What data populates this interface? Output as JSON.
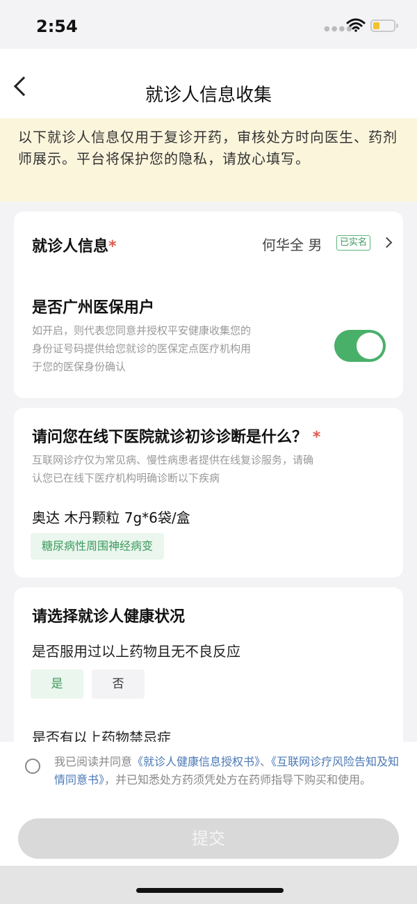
{
  "status_bar": {
    "time": "2:54",
    "battery_color": "#f2c230"
  },
  "nav": {
    "title": "就诊人信息收集"
  },
  "notice": {
    "text": "以下就诊人信息仅用于复诊开药，审核处方时向医生、药剂师展示。平台将保护您的隐私，请放心填写。"
  },
  "patient_card": {
    "label": "就诊人信息",
    "required_mark": "*",
    "patient": "何华全 男",
    "verified_badge": "已实名",
    "insurance_label": "是否广州医保用户",
    "insurance_desc_1": "如开启，则代表您同意并授权平安健康收集您的",
    "insurance_desc_2": "身份证号码提供给您就诊的医保定点医疗机构用",
    "insurance_desc_3": "于您的医保身份确认",
    "insurance_enabled": true
  },
  "diagnosis_card": {
    "question": "请问您在线下医院就诊初诊诊断是什么？",
    "required_mark": "*",
    "desc_1": "互联网诊疗仅为常见病、慢性病患者提供在线复诊服务，请确",
    "desc_2": "认您已在线下医疗机构明确诊断以下疾病",
    "drug": "奥达 木丹颗粒 7g*6袋/盒",
    "diagnosis_tag": "糖尿病性周围神经病变"
  },
  "health_card": {
    "title": "请选择就诊人健康状况",
    "q1": "是否服用过以上药物且无不良反应",
    "yes": "是",
    "no": "否",
    "q2": "是否有以上药物禁忌症"
  },
  "footer": {
    "consent_prefix": "我已阅读并同意",
    "link_1": "《就诊人健康信息授权书》",
    "separator": "、",
    "link_2": "《互联网诊疗风险告知及知情同意书》",
    "consent_suffix": "，并已知悉处方药须凭处方在药师指导下购买和使用。",
    "submit": "提交"
  },
  "colors": {
    "accent_green": "#49b06a",
    "notice_bg": "#fbf5dc",
    "required_red": "#e05a4e",
    "link_blue": "#4a78b5"
  }
}
